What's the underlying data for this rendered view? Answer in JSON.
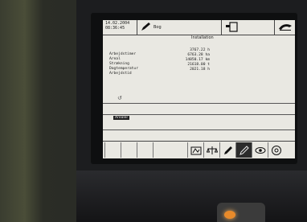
{
  "header": {
    "date": "14.02.2004",
    "time": "08:36:45",
    "user": "Bog",
    "pen_icon": "pen-icon",
    "device_icon": "device-icon",
    "logo_icon": "logo-icon"
  },
  "main": {
    "title": "Installation",
    "labels": [
      "Arbejdstimer",
      "Areal",
      "Strækning",
      "Dagtemperatur",
      "Arbejdstid"
    ],
    "values": [
      "3767.22 h",
      "6763.28 ha",
      "14050.17 km",
      "21618.00 t",
      "2021.18 h"
    ],
    "marker": "↺",
    "selected_tag": "Arealer"
  },
  "toolbar": {
    "icons": [
      "blank-icon",
      "blank-icon",
      "blank-icon",
      "blank-icon",
      "field-icon",
      "scale-icon",
      "pen-icon",
      "edit-icon",
      "eye-icon",
      "settings-icon"
    ]
  }
}
